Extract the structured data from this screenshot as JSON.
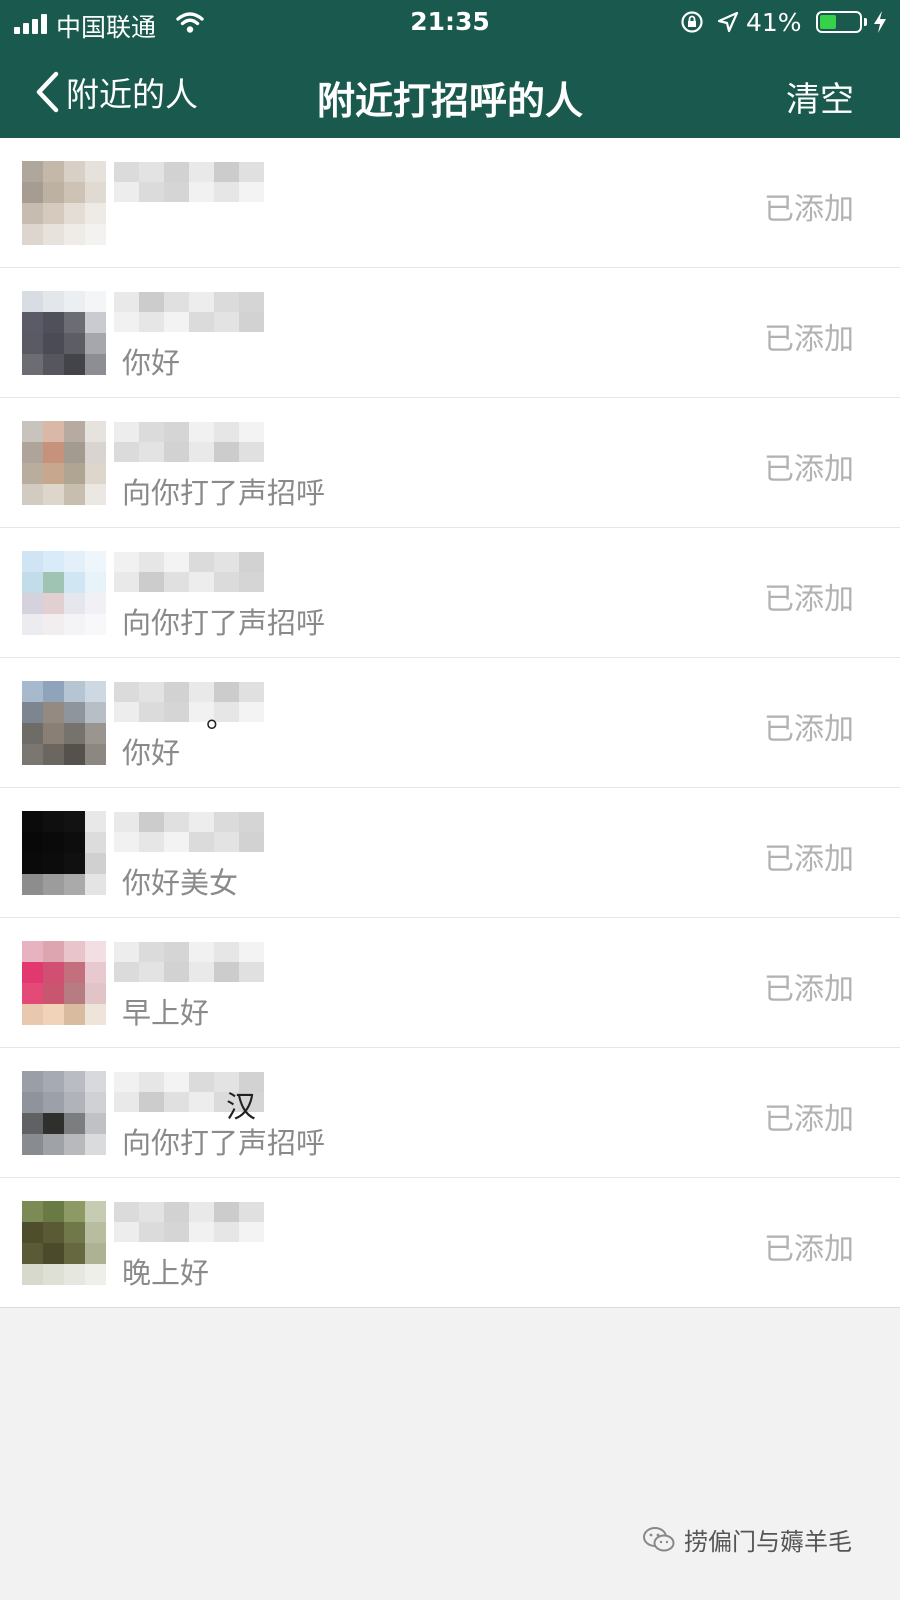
{
  "status_bar": {
    "carrier": "中国联通",
    "time": "21:35",
    "battery_percent_text": "41%",
    "battery_level": 0.41,
    "battery_color": "#36d14b"
  },
  "nav": {
    "back_label": "附近的人",
    "title": "附近打招呼的人",
    "clear_label": "清空",
    "bar_color": "#1a5a4e"
  },
  "rows": [
    {
      "name_tail": "",
      "message": "",
      "status": "已添加",
      "avatar_colors": [
        "#b0a79c",
        "#c4b8a8",
        "#d8d0c6",
        "#e6e1db",
        "#a79c91",
        "#bdb1a2",
        "#cdc2b4",
        "#e0dad2",
        "#c6bcb0",
        "#d5cabd",
        "#e3ddd6",
        "#eeebe7",
        "#dcd6cf",
        "#e7e2dc",
        "#efece8",
        "#f4f2f0"
      ]
    },
    {
      "name_tail": "",
      "message": "你好",
      "status": "已添加",
      "avatar_colors": [
        "#d7dde2",
        "#e3e7ea",
        "#eceff1",
        "#f4f5f6",
        "#5a5b66",
        "#4f505a",
        "#6b6c74",
        "#c9cbd0",
        "#595a64",
        "#4a4b54",
        "#5c5d65",
        "#a6a7ad",
        "#6c6d73",
        "#56575e",
        "#43444a",
        "#8d8e93"
      ]
    },
    {
      "name_tail": "",
      "message": "向你打了声招呼",
      "status": "已添加",
      "avatar_colors": [
        "#c9c3bd",
        "#d9b8a8",
        "#b7aba1",
        "#e6e2de",
        "#aea499",
        "#c6927b",
        "#a39a90",
        "#d9d4cf",
        "#b9ad9d",
        "#c7a88e",
        "#b0a592",
        "#dcd6cc",
        "#d2cbc1",
        "#ddd6cb",
        "#c8beb0",
        "#ebe7e2"
      ]
    },
    {
      "name_tail": "",
      "message": "向你打了声招呼",
      "status": "已添加",
      "avatar_colors": [
        "#cfe4f5",
        "#d9ebf8",
        "#e3f0fa",
        "#eef6fc",
        "#c3dcea",
        "#9fc4b4",
        "#d1e6f3",
        "#e8f2f9",
        "#d6d2dd",
        "#e2cfd2",
        "#e6e6ee",
        "#f1f1f5",
        "#ecebf0",
        "#f2eef0",
        "#f4f3f6",
        "#f8f8fa"
      ]
    },
    {
      "name_tail": "。",
      "message": "你好",
      "status": "已添加",
      "avatar_colors": [
        "#a7b9cc",
        "#8fa3ba",
        "#b6c5d4",
        "#cdd8e2",
        "#7d8590",
        "#958a82",
        "#8e959d",
        "#b8bec5",
        "#6e6c67",
        "#8a7f74",
        "#76726c",
        "#9a958f",
        "#7a7670",
        "#6b6660",
        "#55524d",
        "#8c8780"
      ]
    },
    {
      "name_tail": "",
      "message": "你好美女",
      "status": "已添加",
      "avatar_colors": [
        "#0b0b0b",
        "#0f0f0f",
        "#121212",
        "#e8e8e8",
        "#080808",
        "#0a0a0a",
        "#0d0d0d",
        "#dcdcdc",
        "#0a0a0a",
        "#0c0c0c",
        "#101010",
        "#d0d0d0",
        "#8d8d8d",
        "#9c9c9c",
        "#aaaaaa",
        "#e4e4e4"
      ]
    },
    {
      "name_tail": "",
      "message": "早上好",
      "status": "已添加",
      "avatar_colors": [
        "#e7b3c1",
        "#dca5b0",
        "#e9c4cb",
        "#f1dfe3",
        "#e0386f",
        "#d24f74",
        "#c46f7e",
        "#e7c9cf",
        "#e34a78",
        "#c8566f",
        "#b77b82",
        "#e0c4c7",
        "#e8c8ae",
        "#f0d3b8",
        "#d9bc9f",
        "#efe4da"
      ]
    },
    {
      "name_tail": "汉",
      "message": "向你打了声招呼",
      "status": "已添加",
      "avatar_colors": [
        "#9a9ea7",
        "#a6aab2",
        "#b9bcc3",
        "#d7d9dd",
        "#8f939b",
        "#9ca0a8",
        "#b0b3ba",
        "#cfd1d5",
        "#5f6162",
        "#2f302e",
        "#7b7d7f",
        "#bfc1c4",
        "#888b8f",
        "#9fa2a6",
        "#b7b9bc",
        "#dadbdd"
      ]
    },
    {
      "name_tail": "",
      "message": "晚上好",
      "status": "已添加",
      "avatar_colors": [
        "#7c8a55",
        "#6a7a45",
        "#8e9a64",
        "#c6ccb2",
        "#4e4d2c",
        "#5a5a34",
        "#707748",
        "#b8bd9f",
        "#5b5a36",
        "#4b4a2a",
        "#666840",
        "#aeb295",
        "#d7d9cc",
        "#dfe0d5",
        "#e6e7de",
        "#eeefe9"
      ]
    }
  ],
  "watermark": "捞偏门与薅羊毛"
}
